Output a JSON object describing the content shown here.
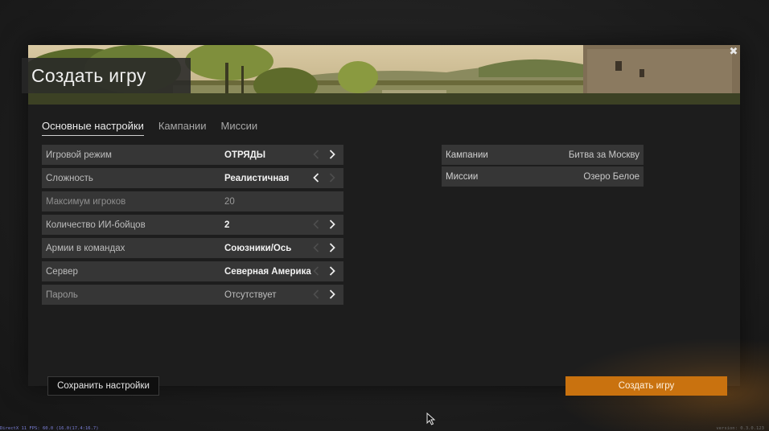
{
  "dialog": {
    "title": "Создать игру",
    "close_glyph": "✖"
  },
  "tabs": [
    {
      "label": "Основные настройки",
      "active": true
    },
    {
      "label": "Кампании",
      "active": false
    },
    {
      "label": "Миссии",
      "active": false
    }
  ],
  "settings": [
    {
      "label": "Игровой режим",
      "value": "ОТРЯДЫ",
      "state": "normal"
    },
    {
      "label": "Сложность",
      "value": "Реалистичная",
      "state": "normal"
    },
    {
      "label": "Максимум игроков",
      "value": "20",
      "state": "disabled"
    },
    {
      "label": "Количество ИИ-бойцов",
      "value": "2",
      "state": "normal"
    },
    {
      "label": "Армии в командах",
      "value": "Союзники/Ось",
      "state": "normal"
    },
    {
      "label": "Сервер",
      "value": "Северная Америка",
      "state": "normal"
    },
    {
      "label": "Пароль",
      "value": "Отсутствует",
      "state": "muted"
    }
  ],
  "summary": [
    {
      "label": "Кампании",
      "value": "Битва за Москву"
    },
    {
      "label": "Миссии",
      "value": "Озеро Белое"
    }
  ],
  "buttons": {
    "save_settings": "Сохранить настройки",
    "create_game": "Создать игру"
  },
  "footer": {
    "fps_text": "DirectX 11 FPS: 60.0 (16.0(17.4:16.7)",
    "version_text": "version: 0.3.0.123"
  },
  "colors": {
    "accent": "#c9720f",
    "row_bg": "#363636",
    "dialog_bg": "#1d1d1d"
  },
  "icons": {
    "close": "close-icon",
    "prev": "chevron-left-icon",
    "next": "chevron-right-icon",
    "cursor": "mouse-pointer-icon"
  }
}
